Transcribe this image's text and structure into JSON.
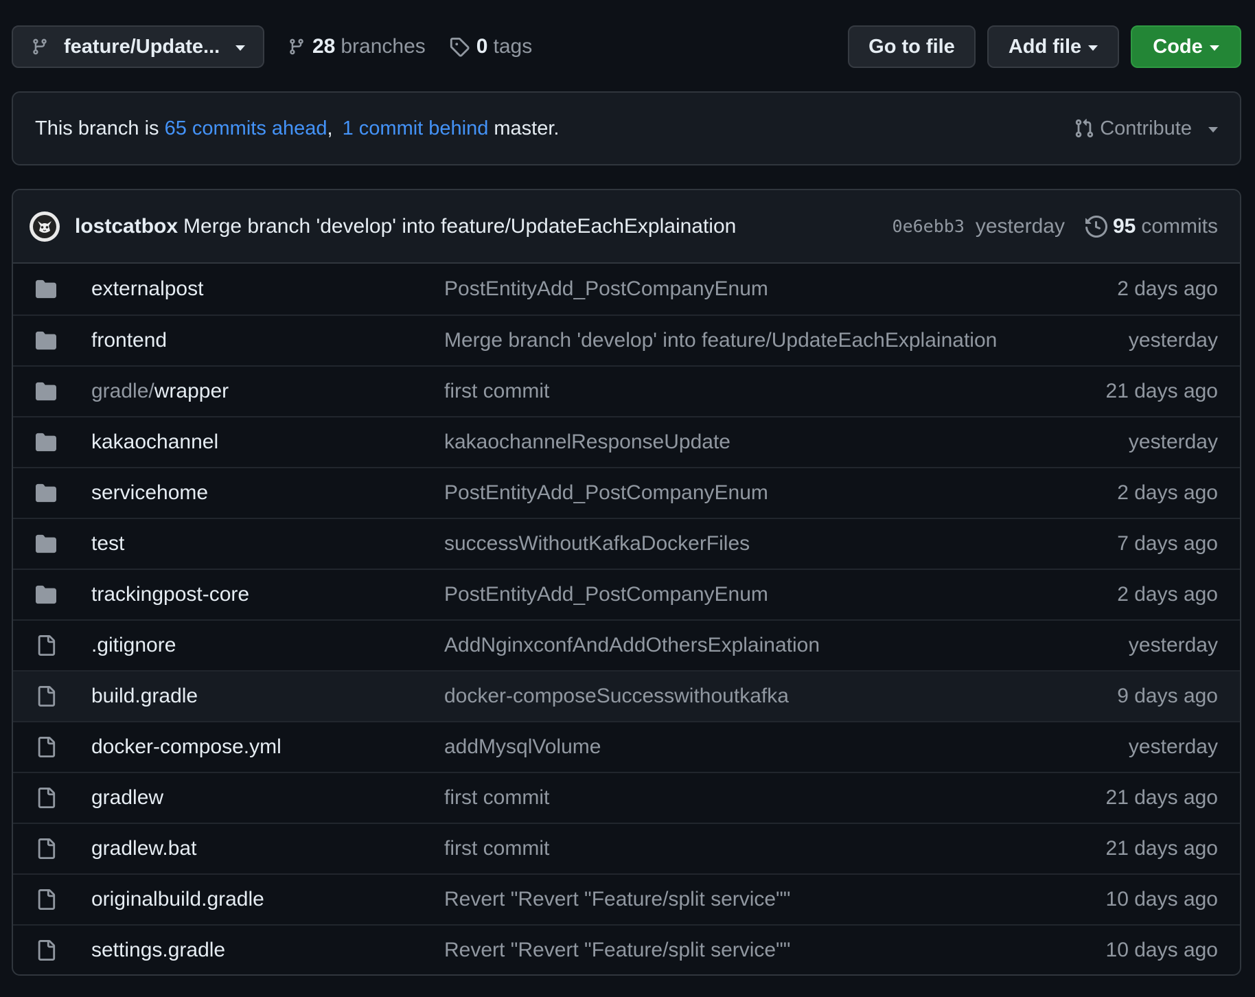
{
  "toolbar": {
    "branch": "feature/Update...",
    "branches_count": "28",
    "branches_label": "branches",
    "tags_count": "0",
    "tags_label": "tags",
    "goto_file": "Go to file",
    "add_file": "Add file",
    "code": "Code"
  },
  "status": {
    "prefix": "This branch is ",
    "ahead": "65 commits ahead",
    "sep": ",",
    "behind": "1 commit behind",
    "suffix": "master.",
    "contribute": "Contribute"
  },
  "latest_commit": {
    "author": "lostcatbox",
    "message": "Merge branch 'develop' into feature/UpdateEachExplaination",
    "sha": "0e6ebb3",
    "time": "yesterday",
    "commits_count": "95",
    "commits_label": "commits"
  },
  "files": [
    {
      "type": "dir",
      "name": "externalpost",
      "message": "PostEntityAdd_PostCompanyEnum",
      "age": "2 days ago"
    },
    {
      "type": "dir",
      "name": "frontend",
      "message": "Merge branch 'develop' into feature/UpdateEachExplaination",
      "age": "yesterday"
    },
    {
      "type": "dir",
      "prefix": "gradle/",
      "name": "wrapper",
      "message": "first commit",
      "age": "21 days ago"
    },
    {
      "type": "dir",
      "name": "kakaochannel",
      "message": "kakaochannelResponseUpdate",
      "age": "yesterday"
    },
    {
      "type": "dir",
      "name": "servicehome",
      "message": "PostEntityAdd_PostCompanyEnum",
      "age": "2 days ago"
    },
    {
      "type": "dir",
      "name": "test",
      "message": "successWithoutKafkaDockerFiles",
      "age": "7 days ago"
    },
    {
      "type": "dir",
      "name": "trackingpost-core",
      "message": "PostEntityAdd_PostCompanyEnum",
      "age": "2 days ago"
    },
    {
      "type": "file",
      "name": ".gitignore",
      "message": "AddNginxconfAndAddOthersExplaination",
      "age": "yesterday"
    },
    {
      "type": "file",
      "name": "build.gradle",
      "message": "docker-composeSuccesswithoutkafka",
      "age": "9 days ago"
    },
    {
      "type": "file",
      "name": "docker-compose.yml",
      "message": "addMysqlVolume",
      "age": "yesterday"
    },
    {
      "type": "file",
      "name": "gradlew",
      "message": "first commit",
      "age": "21 days ago"
    },
    {
      "type": "file",
      "name": "gradlew.bat",
      "message": "first commit",
      "age": "21 days ago"
    },
    {
      "type": "file",
      "name": "originalbuild.gradle",
      "message": "Revert \"Revert \"Feature/split service\"\"",
      "age": "10 days ago"
    },
    {
      "type": "file",
      "name": "settings.gradle",
      "message": "Revert \"Revert \"Feature/split service\"\"",
      "age": "10 days ago"
    }
  ],
  "colors": {
    "background": "#0d1117",
    "link": "#4493f8",
    "code_button": "#238636",
    "muted_text": "#9198a1"
  }
}
